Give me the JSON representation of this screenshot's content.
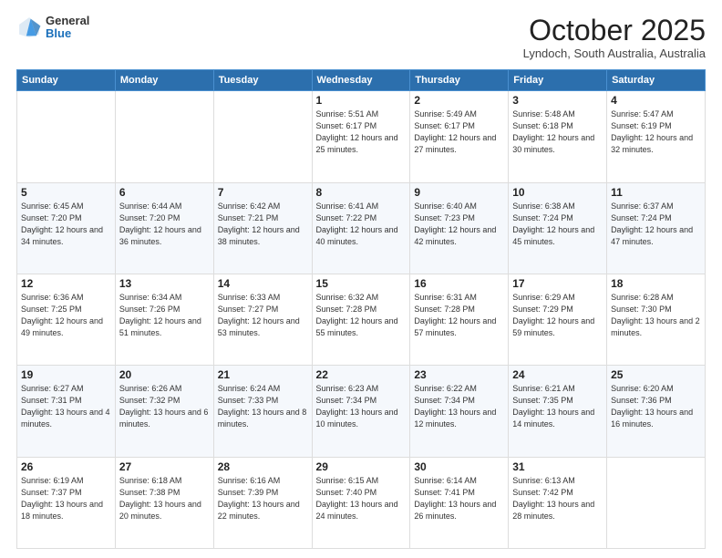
{
  "header": {
    "logo": {
      "general": "General",
      "blue": "Blue"
    },
    "title": "October 2025",
    "location": "Lyndoch, South Australia, Australia"
  },
  "days_of_week": [
    "Sunday",
    "Monday",
    "Tuesday",
    "Wednesday",
    "Thursday",
    "Friday",
    "Saturday"
  ],
  "weeks": [
    [
      null,
      null,
      null,
      {
        "day": "1",
        "sunrise": "Sunrise: 5:51 AM",
        "sunset": "Sunset: 6:17 PM",
        "daylight": "Daylight: 12 hours and 25 minutes."
      },
      {
        "day": "2",
        "sunrise": "Sunrise: 5:49 AM",
        "sunset": "Sunset: 6:17 PM",
        "daylight": "Daylight: 12 hours and 27 minutes."
      },
      {
        "day": "3",
        "sunrise": "Sunrise: 5:48 AM",
        "sunset": "Sunset: 6:18 PM",
        "daylight": "Daylight: 12 hours and 30 minutes."
      },
      {
        "day": "4",
        "sunrise": "Sunrise: 5:47 AM",
        "sunset": "Sunset: 6:19 PM",
        "daylight": "Daylight: 12 hours and 32 minutes."
      }
    ],
    [
      {
        "day": "5",
        "sunrise": "Sunrise: 6:45 AM",
        "sunset": "Sunset: 7:20 PM",
        "daylight": "Daylight: 12 hours and 34 minutes."
      },
      {
        "day": "6",
        "sunrise": "Sunrise: 6:44 AM",
        "sunset": "Sunset: 7:20 PM",
        "daylight": "Daylight: 12 hours and 36 minutes."
      },
      {
        "day": "7",
        "sunrise": "Sunrise: 6:42 AM",
        "sunset": "Sunset: 7:21 PM",
        "daylight": "Daylight: 12 hours and 38 minutes."
      },
      {
        "day": "8",
        "sunrise": "Sunrise: 6:41 AM",
        "sunset": "Sunset: 7:22 PM",
        "daylight": "Daylight: 12 hours and 40 minutes."
      },
      {
        "day": "9",
        "sunrise": "Sunrise: 6:40 AM",
        "sunset": "Sunset: 7:23 PM",
        "daylight": "Daylight: 12 hours and 42 minutes."
      },
      {
        "day": "10",
        "sunrise": "Sunrise: 6:38 AM",
        "sunset": "Sunset: 7:24 PM",
        "daylight": "Daylight: 12 hours and 45 minutes."
      },
      {
        "day": "11",
        "sunrise": "Sunrise: 6:37 AM",
        "sunset": "Sunset: 7:24 PM",
        "daylight": "Daylight: 12 hours and 47 minutes."
      }
    ],
    [
      {
        "day": "12",
        "sunrise": "Sunrise: 6:36 AM",
        "sunset": "Sunset: 7:25 PM",
        "daylight": "Daylight: 12 hours and 49 minutes."
      },
      {
        "day": "13",
        "sunrise": "Sunrise: 6:34 AM",
        "sunset": "Sunset: 7:26 PM",
        "daylight": "Daylight: 12 hours and 51 minutes."
      },
      {
        "day": "14",
        "sunrise": "Sunrise: 6:33 AM",
        "sunset": "Sunset: 7:27 PM",
        "daylight": "Daylight: 12 hours and 53 minutes."
      },
      {
        "day": "15",
        "sunrise": "Sunrise: 6:32 AM",
        "sunset": "Sunset: 7:28 PM",
        "daylight": "Daylight: 12 hours and 55 minutes."
      },
      {
        "day": "16",
        "sunrise": "Sunrise: 6:31 AM",
        "sunset": "Sunset: 7:28 PM",
        "daylight": "Daylight: 12 hours and 57 minutes."
      },
      {
        "day": "17",
        "sunrise": "Sunrise: 6:29 AM",
        "sunset": "Sunset: 7:29 PM",
        "daylight": "Daylight: 12 hours and 59 minutes."
      },
      {
        "day": "18",
        "sunrise": "Sunrise: 6:28 AM",
        "sunset": "Sunset: 7:30 PM",
        "daylight": "Daylight: 13 hours and 2 minutes."
      }
    ],
    [
      {
        "day": "19",
        "sunrise": "Sunrise: 6:27 AM",
        "sunset": "Sunset: 7:31 PM",
        "daylight": "Daylight: 13 hours and 4 minutes."
      },
      {
        "day": "20",
        "sunrise": "Sunrise: 6:26 AM",
        "sunset": "Sunset: 7:32 PM",
        "daylight": "Daylight: 13 hours and 6 minutes."
      },
      {
        "day": "21",
        "sunrise": "Sunrise: 6:24 AM",
        "sunset": "Sunset: 7:33 PM",
        "daylight": "Daylight: 13 hours and 8 minutes."
      },
      {
        "day": "22",
        "sunrise": "Sunrise: 6:23 AM",
        "sunset": "Sunset: 7:34 PM",
        "daylight": "Daylight: 13 hours and 10 minutes."
      },
      {
        "day": "23",
        "sunrise": "Sunrise: 6:22 AM",
        "sunset": "Sunset: 7:34 PM",
        "daylight": "Daylight: 13 hours and 12 minutes."
      },
      {
        "day": "24",
        "sunrise": "Sunrise: 6:21 AM",
        "sunset": "Sunset: 7:35 PM",
        "daylight": "Daylight: 13 hours and 14 minutes."
      },
      {
        "day": "25",
        "sunrise": "Sunrise: 6:20 AM",
        "sunset": "Sunset: 7:36 PM",
        "daylight": "Daylight: 13 hours and 16 minutes."
      }
    ],
    [
      {
        "day": "26",
        "sunrise": "Sunrise: 6:19 AM",
        "sunset": "Sunset: 7:37 PM",
        "daylight": "Daylight: 13 hours and 18 minutes."
      },
      {
        "day": "27",
        "sunrise": "Sunrise: 6:18 AM",
        "sunset": "Sunset: 7:38 PM",
        "daylight": "Daylight: 13 hours and 20 minutes."
      },
      {
        "day": "28",
        "sunrise": "Sunrise: 6:16 AM",
        "sunset": "Sunset: 7:39 PM",
        "daylight": "Daylight: 13 hours and 22 minutes."
      },
      {
        "day": "29",
        "sunrise": "Sunrise: 6:15 AM",
        "sunset": "Sunset: 7:40 PM",
        "daylight": "Daylight: 13 hours and 24 minutes."
      },
      {
        "day": "30",
        "sunrise": "Sunrise: 6:14 AM",
        "sunset": "Sunset: 7:41 PM",
        "daylight": "Daylight: 13 hours and 26 minutes."
      },
      {
        "day": "31",
        "sunrise": "Sunrise: 6:13 AM",
        "sunset": "Sunset: 7:42 PM",
        "daylight": "Daylight: 13 hours and 28 minutes."
      },
      null
    ]
  ]
}
